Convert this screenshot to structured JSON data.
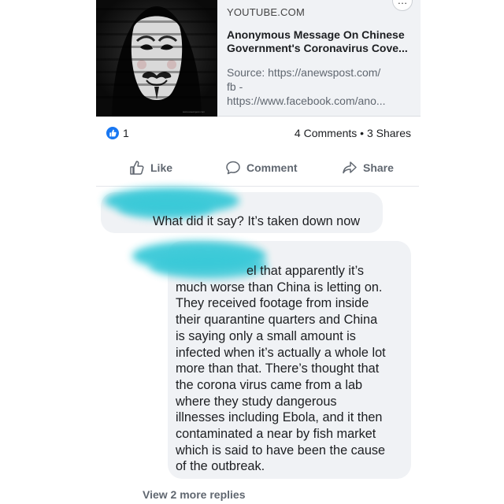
{
  "link_preview": {
    "source_domain": "YOUTUBE.COM",
    "title_lines": [
      "Anonymous Message On Chinese",
      "Government's Coronavirus Cove..."
    ],
    "description_lines": [
      "Source: https://anewspost.com/",
      "fb -",
      "https://www.facebook.com/ano..."
    ],
    "thumbnail_icon": "guy-fawkes-mask-icon",
    "thumbnail_credit": "www.anewspost.com"
  },
  "reactions": {
    "icon": "thumbs-up-icon",
    "count": "1",
    "color": "#1877f2",
    "comments_shares": "4 Comments • 3 Shares"
  },
  "actions": {
    "like_label": "Like",
    "comment_label": "Comment",
    "share_label": "Share"
  },
  "comments": [
    {
      "author_redacted": true,
      "text": "What did it say? It’s taken down now"
    },
    {
      "author_redacted": true,
      "lines": [
        "el that apparently it’s",
        "much worse than China is letting on.",
        "They received footage from inside",
        "their quarantine quarters and China",
        "is saying only a small amount is",
        "infected when it’s actually a whole lot",
        "more than that. There’s thought that",
        "the corona virus came from a lab",
        "where they study dangerous",
        "illnesses including Ebola, and it then",
        "contaminated a near by fish market",
        "which is said to have been the cause",
        "of the outbreak."
      ]
    }
  ],
  "view_more_replies": "View 2 more replies"
}
